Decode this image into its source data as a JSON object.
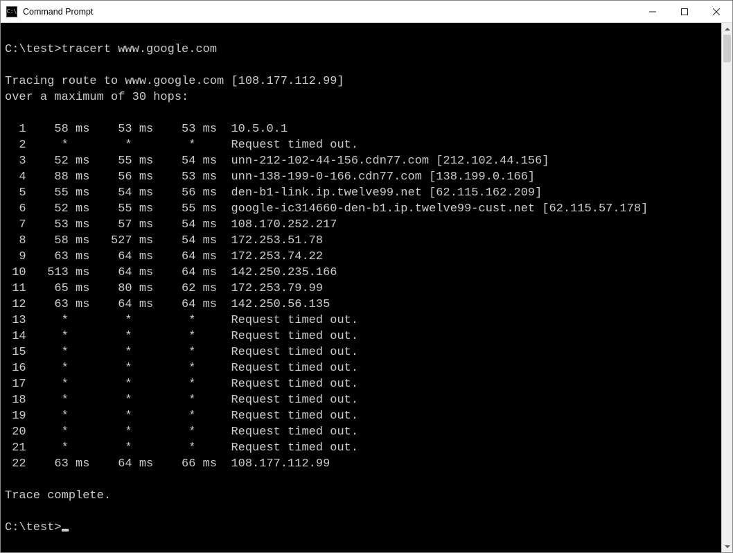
{
  "window": {
    "title": "Command Prompt"
  },
  "terminal": {
    "prompt1": "C:\\test>",
    "command": "tracert www.google.com",
    "tracing_line1": "Tracing route to www.google.com [108.177.112.99]",
    "tracing_line2": "over a maximum of 30 hops:",
    "hops": [
      {
        "n": "1",
        "t1": "58 ms",
        "t2": "53 ms",
        "t3": "53 ms",
        "host": "10.5.0.1"
      },
      {
        "n": "2",
        "t1": "*",
        "t2": "*",
        "t3": "*",
        "host": "Request timed out."
      },
      {
        "n": "3",
        "t1": "52 ms",
        "t2": "55 ms",
        "t3": "54 ms",
        "host": "unn-212-102-44-156.cdn77.com [212.102.44.156]"
      },
      {
        "n": "4",
        "t1": "88 ms",
        "t2": "56 ms",
        "t3": "53 ms",
        "host": "unn-138-199-0-166.cdn77.com [138.199.0.166]"
      },
      {
        "n": "5",
        "t1": "55 ms",
        "t2": "54 ms",
        "t3": "56 ms",
        "host": "den-b1-link.ip.twelve99.net [62.115.162.209]"
      },
      {
        "n": "6",
        "t1": "52 ms",
        "t2": "55 ms",
        "t3": "55 ms",
        "host": "google-ic314660-den-b1.ip.twelve99-cust.net [62.115.57.178]"
      },
      {
        "n": "7",
        "t1": "53 ms",
        "t2": "57 ms",
        "t3": "54 ms",
        "host": "108.170.252.217"
      },
      {
        "n": "8",
        "t1": "58 ms",
        "t2": "527 ms",
        "t3": "54 ms",
        "host": "172.253.51.78"
      },
      {
        "n": "9",
        "t1": "63 ms",
        "t2": "64 ms",
        "t3": "64 ms",
        "host": "172.253.74.22"
      },
      {
        "n": "10",
        "t1": "513 ms",
        "t2": "64 ms",
        "t3": "64 ms",
        "host": "142.250.235.166"
      },
      {
        "n": "11",
        "t1": "65 ms",
        "t2": "80 ms",
        "t3": "62 ms",
        "host": "172.253.79.99"
      },
      {
        "n": "12",
        "t1": "63 ms",
        "t2": "64 ms",
        "t3": "64 ms",
        "host": "142.250.56.135"
      },
      {
        "n": "13",
        "t1": "*",
        "t2": "*",
        "t3": "*",
        "host": "Request timed out."
      },
      {
        "n": "14",
        "t1": "*",
        "t2": "*",
        "t3": "*",
        "host": "Request timed out."
      },
      {
        "n": "15",
        "t1": "*",
        "t2": "*",
        "t3": "*",
        "host": "Request timed out."
      },
      {
        "n": "16",
        "t1": "*",
        "t2": "*",
        "t3": "*",
        "host": "Request timed out."
      },
      {
        "n": "17",
        "t1": "*",
        "t2": "*",
        "t3": "*",
        "host": "Request timed out."
      },
      {
        "n": "18",
        "t1": "*",
        "t2": "*",
        "t3": "*",
        "host": "Request timed out."
      },
      {
        "n": "19",
        "t1": "*",
        "t2": "*",
        "t3": "*",
        "host": "Request timed out."
      },
      {
        "n": "20",
        "t1": "*",
        "t2": "*",
        "t3": "*",
        "host": "Request timed out."
      },
      {
        "n": "21",
        "t1": "*",
        "t2": "*",
        "t3": "*",
        "host": "Request timed out."
      },
      {
        "n": "22",
        "t1": "63 ms",
        "t2": "64 ms",
        "t3": "66 ms",
        "host": "108.177.112.99"
      }
    ],
    "complete": "Trace complete.",
    "prompt2": "C:\\test>"
  }
}
